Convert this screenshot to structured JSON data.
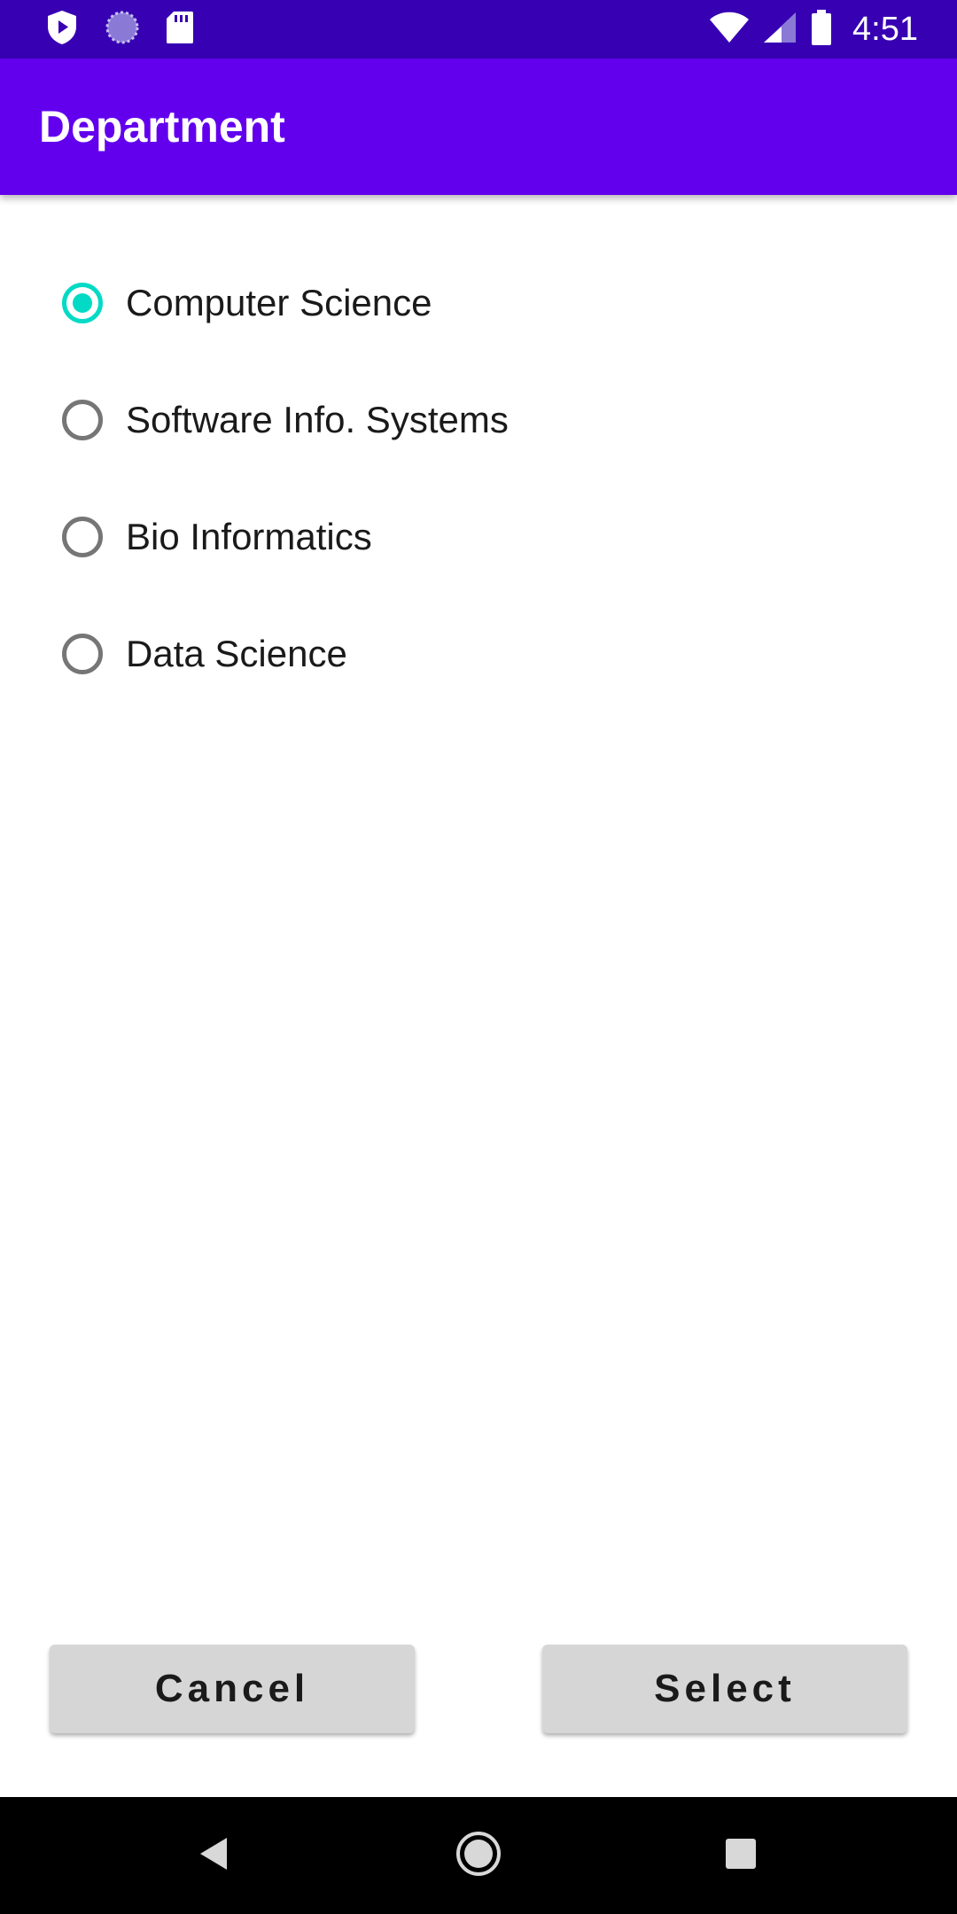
{
  "status_bar": {
    "time": "4:51",
    "icons": [
      "play-protect-icon",
      "sync-icon",
      "sd-card-icon",
      "wifi-icon",
      "signal-icon",
      "battery-icon"
    ]
  },
  "app_bar": {
    "title": "Department"
  },
  "departments": {
    "options": [
      {
        "label": "Computer Science",
        "checked": true
      },
      {
        "label": "Software Info. Systems",
        "checked": false
      },
      {
        "label": "Bio Informatics",
        "checked": false
      },
      {
        "label": "Data Science",
        "checked": false
      }
    ]
  },
  "actions": {
    "cancel_label": "Cancel",
    "select_label": "Select"
  },
  "navigation": {
    "icons": [
      "back-icon",
      "home-icon",
      "recents-icon"
    ]
  },
  "colors": {
    "status_bar": "#3700b3",
    "app_bar": "#6200ee",
    "radio_checked": "#03dac5",
    "radio_unchecked": "#767676",
    "button_bg": "#d6d6d6"
  }
}
